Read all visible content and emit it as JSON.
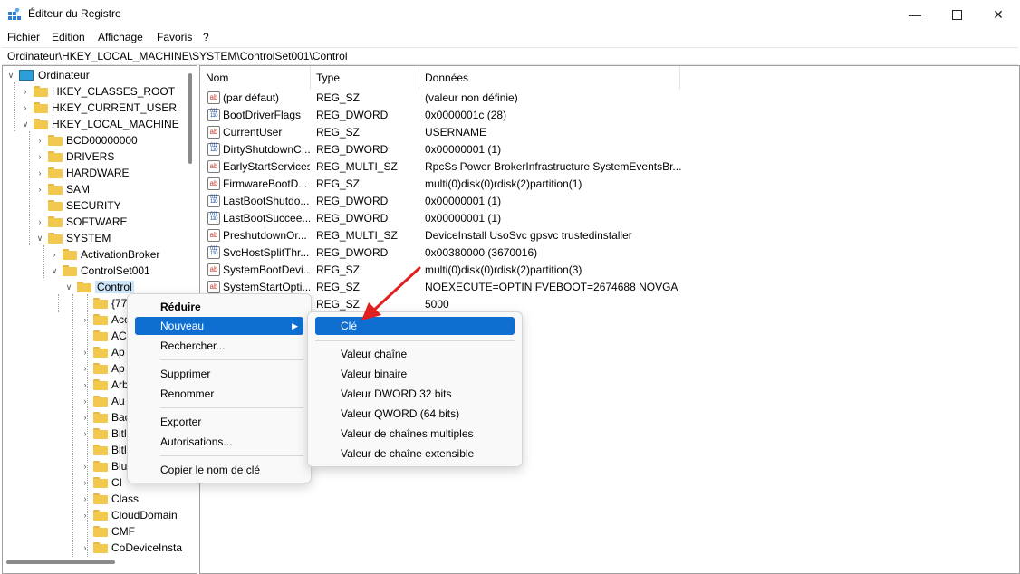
{
  "window": {
    "title": "Éditeur du Registre",
    "minimize_icon": "minimize-icon",
    "maximize_icon": "maximize-icon",
    "close_icon": "close-icon"
  },
  "menubar": {
    "items": [
      "Fichier",
      "Edition",
      "Affichage",
      "Favoris",
      "?"
    ]
  },
  "address": {
    "path": "Ordinateur\\HKEY_LOCAL_MACHINE\\SYSTEM\\ControlSet001\\Control"
  },
  "tree": {
    "root": "Ordinateur",
    "hives": [
      "HKEY_CLASSES_ROOT",
      "HKEY_CURRENT_USER",
      "HKEY_LOCAL_MACHINE"
    ],
    "hklm_children": [
      "BCD00000000",
      "DRIVERS",
      "HARDWARE",
      "SAM",
      "SECURITY",
      "SOFTWARE",
      "SYSTEM"
    ],
    "system_children": [
      "ActivationBroker",
      "ControlSet001"
    ],
    "selected": "Control",
    "control_children": [
      "{77",
      "Acc",
      "AC",
      "Ap",
      "Ap",
      "Arb",
      "Au",
      "Bac",
      "Bitl",
      "Bitl",
      "Blu",
      "CI",
      "Class",
      "CloudDomain",
      "CMF",
      "CoDeviceInsta"
    ]
  },
  "list": {
    "columns": [
      "Nom",
      "Type",
      "Données"
    ],
    "rows": [
      {
        "icon": "string",
        "name": "(par défaut)",
        "type": "REG_SZ",
        "data": "(valeur non définie)"
      },
      {
        "icon": "binary",
        "name": "BootDriverFlags",
        "type": "REG_DWORD",
        "data": "0x0000001c (28)"
      },
      {
        "icon": "string",
        "name": "CurrentUser",
        "type": "REG_SZ",
        "data": "USERNAME"
      },
      {
        "icon": "binary",
        "name": "DirtyShutdownC...",
        "type": "REG_DWORD",
        "data": "0x00000001 (1)"
      },
      {
        "icon": "string",
        "name": "EarlyStartServices",
        "type": "REG_MULTI_SZ",
        "data": "RpcSs Power BrokerInfrastructure SystemEventsBr..."
      },
      {
        "icon": "string",
        "name": "FirmwareBootD...",
        "type": "REG_SZ",
        "data": "multi(0)disk(0)rdisk(2)partition(1)"
      },
      {
        "icon": "binary",
        "name": "LastBootShutdo...",
        "type": "REG_DWORD",
        "data": "0x00000001 (1)"
      },
      {
        "icon": "binary",
        "name": "LastBootSuccee...",
        "type": "REG_DWORD",
        "data": "0x00000001 (1)"
      },
      {
        "icon": "string",
        "name": "PreshutdownOr...",
        "type": "REG_MULTI_SZ",
        "data": "DeviceInstall UsoSvc gpsvc trustedinstaller"
      },
      {
        "icon": "binary",
        "name": "SvcHostSplitThr...",
        "type": "REG_DWORD",
        "data": "0x00380000 (3670016)"
      },
      {
        "icon": "string",
        "name": "SystemBootDevi...",
        "type": "REG_SZ",
        "data": "multi(0)disk(0)rdisk(2)partition(3)"
      },
      {
        "icon": "string",
        "name": "SystemStartOpti...",
        "type": "REG_SZ",
        "data": " NOEXECUTE=OPTIN  FVEBOOT=2674688  NOVGA"
      },
      {
        "icon": "string",
        "name": "",
        "type": "REG_SZ",
        "data": "5000"
      }
    ]
  },
  "context_menu": {
    "items": [
      "Réduire",
      "Nouveau",
      "Rechercher...",
      "Supprimer",
      "Renommer",
      "Exporter",
      "Autorisations...",
      "Copier le nom de clé"
    ],
    "highlighted": "Nouveau"
  },
  "submenu": {
    "items": [
      "Clé",
      "Valeur chaîne",
      "Valeur binaire",
      "Valeur DWORD 32 bits",
      "Valeur QWORD (64 bits)",
      "Valeur de chaînes multiples",
      "Valeur de chaîne extensible"
    ],
    "highlighted": "Clé"
  },
  "colors": {
    "highlight": "#0f6fd0",
    "arrow": "#e02020",
    "folder": "#f3c84e"
  }
}
